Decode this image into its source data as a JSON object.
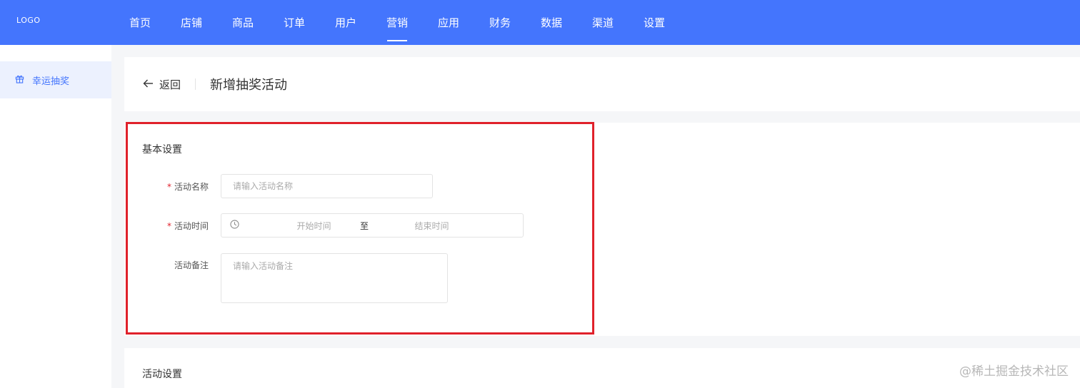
{
  "logo": "LOGO",
  "nav": {
    "items": [
      {
        "label": "首页"
      },
      {
        "label": "店铺"
      },
      {
        "label": "商品"
      },
      {
        "label": "订单"
      },
      {
        "label": "用户"
      },
      {
        "label": "营销"
      },
      {
        "label": "应用"
      },
      {
        "label": "财务"
      },
      {
        "label": "数据"
      },
      {
        "label": "渠道"
      },
      {
        "label": "设置"
      }
    ],
    "active": "营销"
  },
  "sidebar": {
    "items": [
      {
        "label": "幸运抽奖",
        "icon": "gift-icon"
      }
    ]
  },
  "header": {
    "back_label": "返回",
    "title": "新增抽奖活动"
  },
  "basic": {
    "section_title": "基本设置",
    "required_mark": "*",
    "name_label": "活动名称",
    "name_placeholder": "请输入活动名称",
    "time_label": "活动时间",
    "time_start_placeholder": "开始时间",
    "time_separator": "至",
    "time_end_placeholder": "结束时间",
    "remark_label": "活动备注",
    "remark_placeholder": "请输入活动备注"
  },
  "activity": {
    "section_title": "活动设置"
  },
  "watermark": "@稀土掘金技术社区",
  "colors": {
    "primary": "#4475fd",
    "highlight": "#e0212b",
    "required": "#e0212b"
  }
}
